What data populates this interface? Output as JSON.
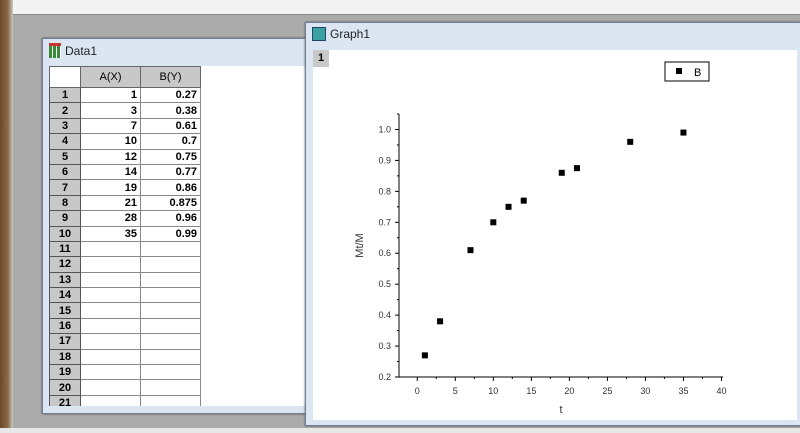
{
  "data_window": {
    "title": "Data1",
    "headers": [
      "A(X)",
      "B(Y)"
    ],
    "rows": [
      [
        "1",
        "1",
        "0.27"
      ],
      [
        "2",
        "3",
        "0.38"
      ],
      [
        "3",
        "7",
        "0.61"
      ],
      [
        "4",
        "10",
        "0.7"
      ],
      [
        "5",
        "12",
        "0.75"
      ],
      [
        "6",
        "14",
        "0.77"
      ],
      [
        "7",
        "19",
        "0.86"
      ],
      [
        "8",
        "21",
        "0.875"
      ],
      [
        "9",
        "28",
        "0.96"
      ],
      [
        "10",
        "35",
        "0.99"
      ],
      [
        "11",
        "",
        ""
      ],
      [
        "12",
        "",
        ""
      ],
      [
        "13",
        "",
        ""
      ],
      [
        "14",
        "",
        ""
      ],
      [
        "15",
        "",
        ""
      ],
      [
        "16",
        "",
        ""
      ],
      [
        "17",
        "",
        ""
      ],
      [
        "18",
        "",
        ""
      ],
      [
        "19",
        "",
        ""
      ],
      [
        "20",
        "",
        ""
      ],
      [
        "21",
        "",
        ""
      ]
    ]
  },
  "graph_window": {
    "title": "Graph1",
    "layer": "1"
  },
  "chart_data": {
    "type": "scatter",
    "x": [
      1,
      3,
      7,
      10,
      12,
      14,
      19,
      21,
      28,
      35
    ],
    "series": [
      {
        "name": "B",
        "values": [
          0.27,
          0.38,
          0.61,
          0.7,
          0.75,
          0.77,
          0.86,
          0.875,
          0.96,
          0.99
        ]
      }
    ],
    "xlabel": "t",
    "ylabel": "Mt/M",
    "xlim": [
      -2.5,
      40
    ],
    "ylim": [
      0.2,
      1.05
    ],
    "xticks": [
      "0",
      "5",
      "10",
      "15",
      "20",
      "25",
      "30",
      "35",
      "40"
    ],
    "yticks": [
      "0.2",
      "0.3",
      "0.4",
      "0.5",
      "0.6",
      "0.7",
      "0.8",
      "0.9",
      "1.0"
    ],
    "legend": "top-right",
    "grid": false,
    "marker": "square",
    "color": "#000000"
  }
}
